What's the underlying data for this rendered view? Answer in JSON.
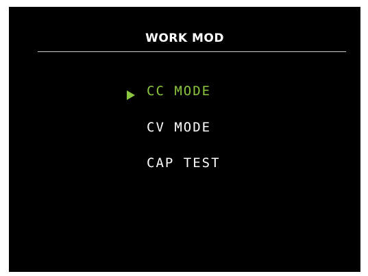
{
  "header": {
    "title": "WORK MOD"
  },
  "menu": {
    "items": [
      {
        "label": "CC MODE",
        "selected": true
      },
      {
        "label": "CV MODE",
        "selected": false
      },
      {
        "label": "CAP TEST",
        "selected": false
      }
    ]
  },
  "colors": {
    "background": "#000000",
    "text": "#ffffff",
    "accent": "#8cc63f",
    "divider": "#cfcfcf"
  },
  "icons": {
    "cursor": "right-triangle-cursor-icon"
  }
}
